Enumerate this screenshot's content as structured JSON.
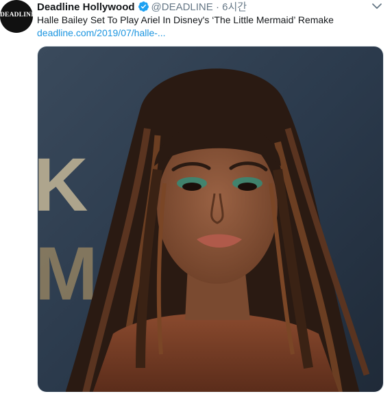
{
  "tweet": {
    "avatar": {
      "text": "DEADLINE",
      "icon": "deadline-logo"
    },
    "author": {
      "display_name": "Deadline Hollywood",
      "verified_icon": "verified-badge-icon",
      "handle": "@DEADLINE",
      "separator": "·",
      "timestamp": "6시간"
    },
    "menu_icon": "chevron-down-icon",
    "text": "Halle Bailey Set To Play Ariel In Disney's ‘The Little Mermaid’ Remake",
    "link_text": "deadline.com/2019/07/halle-...",
    "media": {
      "type": "photo",
      "background_letters": "KL M"
    }
  },
  "colors": {
    "name": "#14171a",
    "secondary": "#657786",
    "link": "#1b95e0",
    "verified": "#1da1f2",
    "photo_backdrop": "#2b3a4c"
  }
}
